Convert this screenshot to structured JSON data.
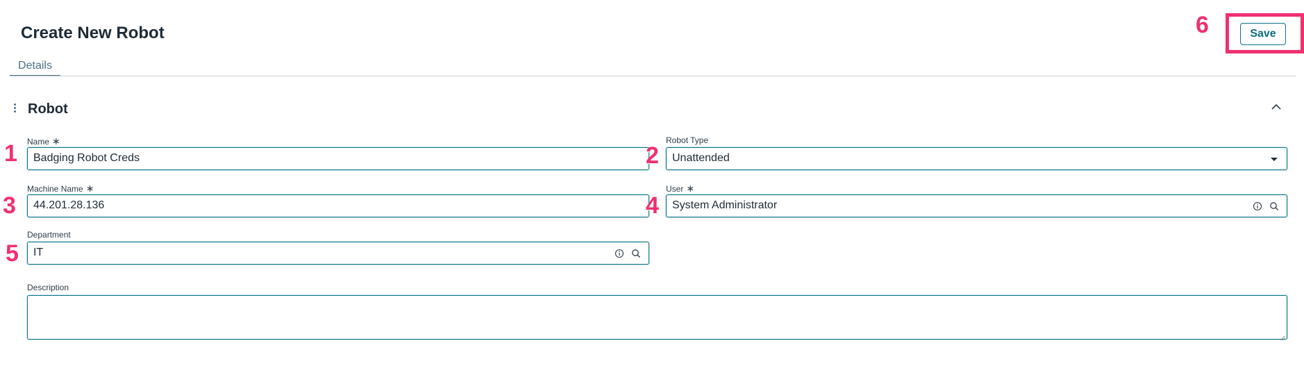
{
  "header": {
    "title": "Create New Robot",
    "save_label": "Save"
  },
  "tabs": [
    {
      "label": "Details",
      "active": true
    }
  ],
  "section": {
    "title": "Robot",
    "collapse_icon": "chevron-up-icon"
  },
  "form": {
    "name": {
      "label": "Name",
      "required_mark": "∗",
      "value": "Badging Robot Creds"
    },
    "robot_type": {
      "label": "Robot Type",
      "value": "Unattended",
      "icon": "caret-down-icon"
    },
    "machine_name": {
      "label": "Machine Name",
      "required_mark": "∗",
      "value": "44.201.28.136"
    },
    "user": {
      "label": "User",
      "required_mark": "∗",
      "value": "System Administrator",
      "icons": [
        "info-icon",
        "search-icon"
      ]
    },
    "department": {
      "label": "Department",
      "value": "IT",
      "icons": [
        "info-icon",
        "search-icon"
      ]
    },
    "description": {
      "label": "Description",
      "value": ""
    }
  },
  "annotations": [
    "1",
    "2",
    "3",
    "4",
    "5",
    "6"
  ],
  "colors": {
    "accent": "#0b7285",
    "annotation": "#f0306f",
    "text": "#1d2b36"
  }
}
